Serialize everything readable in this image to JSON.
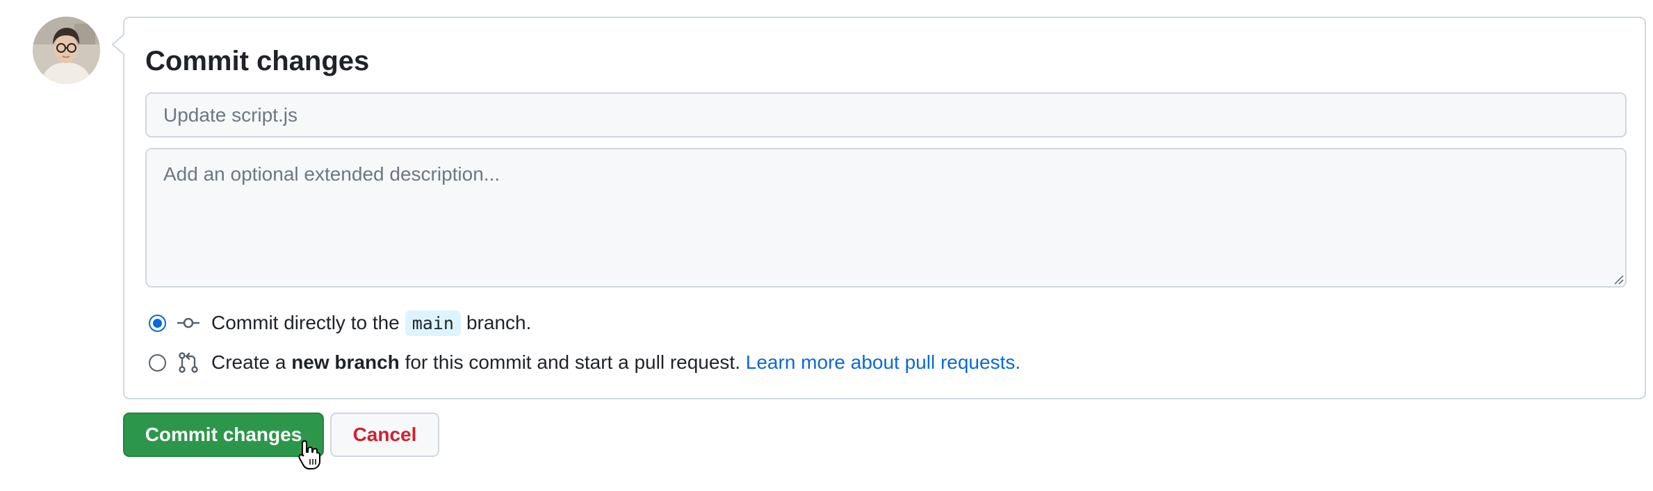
{
  "form": {
    "title": "Commit changes",
    "summary_placeholder": "Update script.js",
    "description_placeholder": "Add an optional extended description..."
  },
  "options": {
    "direct": {
      "prefix": "Commit directly to the",
      "branch": "main",
      "suffix": "branch.",
      "selected": true
    },
    "new_branch": {
      "prefix": "Create a",
      "bold": "new branch",
      "suffix": "for this commit and start a pull request.",
      "link": "Learn more about pull requests.",
      "selected": false
    }
  },
  "buttons": {
    "commit_label": "Commit changes",
    "cancel_label": "Cancel"
  },
  "icons": {
    "direct": "git-commit-icon",
    "new_branch": "git-pull-request-icon"
  },
  "colors": {
    "primary_button": "#2c974b",
    "link": "#0969da",
    "danger": "#cf222e",
    "radio_checked": "#0969da",
    "code_bg": "#ddf4ff"
  }
}
